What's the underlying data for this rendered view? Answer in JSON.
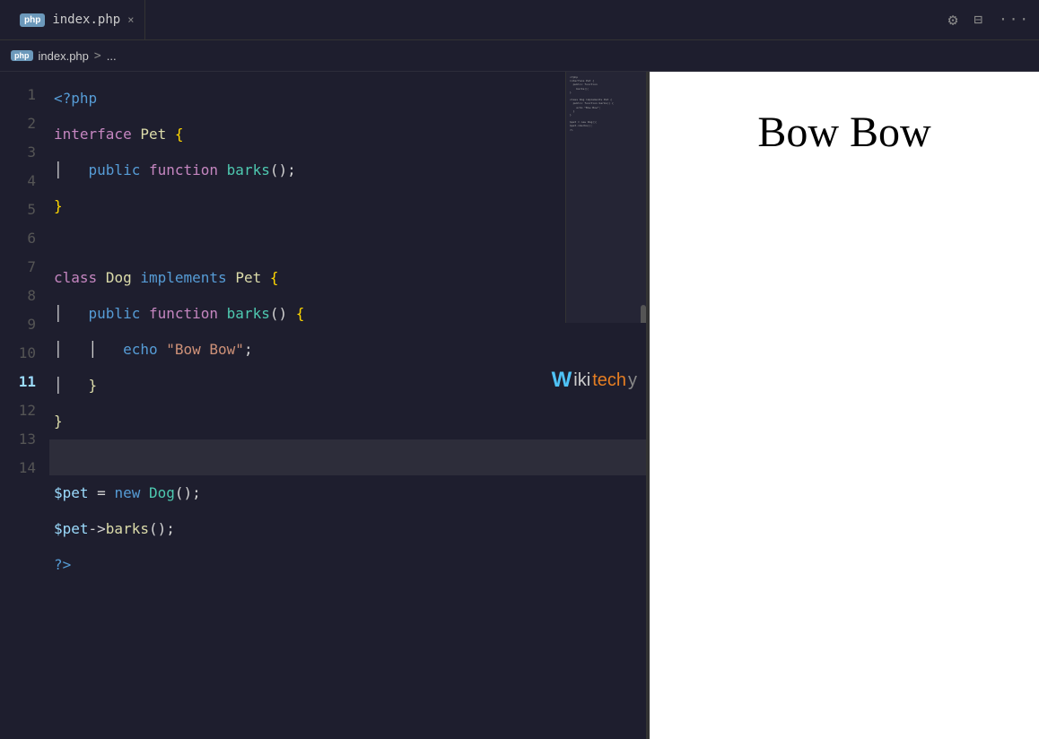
{
  "title_bar": {
    "tab_label": "index.php",
    "tab_close": "×",
    "icon_debug": "⚙",
    "icon_split": "⊞",
    "icon_more": "···"
  },
  "breadcrumb": {
    "php_label": "php",
    "file": "index.php",
    "sep": ">",
    "more": "..."
  },
  "minimap": {
    "content": "<?php\ninterface Pet {\n  public function barks();\n}\n\nclass Dog implements Pet {\n  public function barks() {\n    echo \"Bow Bow\";\n  }\n}\n\n$pet = new Dog();\n$pet->barks();\n?>"
  },
  "watermark": {
    "text": "Wikitechy"
  },
  "lines": [
    {
      "num": "1",
      "content": "<?php",
      "tokens": [
        {
          "text": "<?php",
          "class": "c-php"
        }
      ]
    },
    {
      "num": "2",
      "content": "    interface Pet {",
      "tokens": [
        {
          "text": "    ",
          "class": "c-white"
        },
        {
          "text": "interface",
          "class": "c-purple"
        },
        {
          "text": " Pet ",
          "class": "c-yellow"
        },
        {
          "text": "{",
          "class": "c-brace"
        }
      ]
    },
    {
      "num": "3",
      "content": "        public function barks();",
      "tokens": [
        {
          "text": "    │    ",
          "class": "c-white"
        },
        {
          "text": "public",
          "class": "c-blue"
        },
        {
          "text": " ",
          "class": "c-white"
        },
        {
          "text": "function",
          "class": "c-purple"
        },
        {
          "text": " ",
          "class": "c-white"
        },
        {
          "text": "barks",
          "class": "c-cyan"
        },
        {
          "text": "();",
          "class": "c-white"
        }
      ]
    },
    {
      "num": "4",
      "content": "    }",
      "tokens": [
        {
          "text": "    ",
          "class": "c-white"
        },
        {
          "text": "}",
          "class": "c-brace"
        }
      ]
    },
    {
      "num": "5",
      "content": "",
      "tokens": []
    },
    {
      "num": "6",
      "content": "    class Dog implements Pet {",
      "tokens": [
        {
          "text": "    ",
          "class": "c-white"
        },
        {
          "text": "class",
          "class": "c-purple"
        },
        {
          "text": " Dog ",
          "class": "c-yellow"
        },
        {
          "text": "implements",
          "class": "c-blue"
        },
        {
          "text": " Pet ",
          "class": "c-yellow"
        },
        {
          "text": "{",
          "class": "c-brace"
        }
      ]
    },
    {
      "num": "7",
      "content": "        public function barks() {",
      "tokens": [
        {
          "text": "    │    ",
          "class": "c-white"
        },
        {
          "text": "public",
          "class": "c-blue"
        },
        {
          "text": " ",
          "class": "c-white"
        },
        {
          "text": "function",
          "class": "c-purple"
        },
        {
          "text": " ",
          "class": "c-white"
        },
        {
          "text": "barks",
          "class": "c-cyan"
        },
        {
          "text": "() ",
          "class": "c-white"
        },
        {
          "text": "{",
          "class": "c-brace"
        }
      ]
    },
    {
      "num": "8",
      "content": "            echo \"Bow Bow\";",
      "tokens": [
        {
          "text": "    │    │    ",
          "class": "c-white"
        },
        {
          "text": "echo",
          "class": "c-blue"
        },
        {
          "text": " ",
          "class": "c-white"
        },
        {
          "text": "\"Bow Bow\"",
          "class": "c-orange"
        },
        {
          "text": ";",
          "class": "c-white"
        }
      ]
    },
    {
      "num": "9",
      "content": "        }",
      "tokens": [
        {
          "text": "    │    ",
          "class": "c-white"
        },
        {
          "text": "}",
          "class": "c-yellow"
        }
      ]
    },
    {
      "num": "10",
      "content": "    }",
      "tokens": [
        {
          "text": "    ",
          "class": "c-white"
        },
        {
          "text": "}",
          "class": "c-yellow"
        }
      ]
    },
    {
      "num": "11",
      "content": "",
      "tokens": [],
      "highlighted": true
    },
    {
      "num": "12",
      "content": "    $pet = new Dog();",
      "tokens": [
        {
          "text": "    ",
          "class": "c-white"
        },
        {
          "text": "$pet",
          "class": "c-var"
        },
        {
          "text": " = ",
          "class": "c-white"
        },
        {
          "text": "new",
          "class": "c-blue"
        },
        {
          "text": " ",
          "class": "c-white"
        },
        {
          "text": "Dog",
          "class": "c-cyan"
        },
        {
          "text": "();",
          "class": "c-white"
        }
      ]
    },
    {
      "num": "13",
      "content": "    $pet->barks();",
      "tokens": [
        {
          "text": "    ",
          "class": "c-white"
        },
        {
          "text": "$pet",
          "class": "c-var"
        },
        {
          "text": "->",
          "class": "c-white"
        },
        {
          "text": "barks",
          "class": "c-yellow"
        },
        {
          "text": "();",
          "class": "c-white"
        }
      ]
    },
    {
      "num": "14",
      "content": "    ?>",
      "tokens": [
        {
          "text": "    ",
          "class": "c-white"
        },
        {
          "text": "?>",
          "class": "c-php"
        }
      ]
    }
  ],
  "browser": {
    "output": "Bow Bow"
  }
}
